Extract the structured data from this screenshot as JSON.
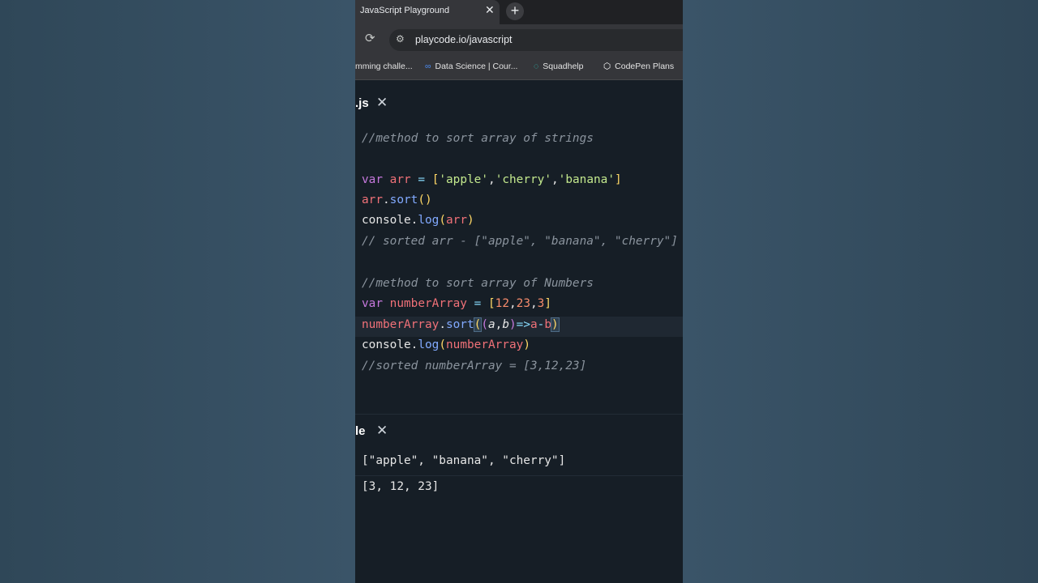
{
  "browser": {
    "tab_title": "JavaScript Playground",
    "tab_close": "✕",
    "new_tab": "+",
    "url": "playcode.io/javascript",
    "bookmarks": [
      {
        "label": "mming challe...",
        "icon": "bookmark-icon"
      },
      {
        "label": "Data Science | Cour...",
        "icon": "infinity-icon"
      },
      {
        "label": "Squadhelp",
        "icon": "squadhelp-icon"
      },
      {
        "label": "CodePen Plans",
        "icon": "codepen-icon"
      }
    ]
  },
  "editor": {
    "tab_label": ".js",
    "tab_close": "✕",
    "lines": {
      "l1": "//method to sort array of strings",
      "l5": "// sorted arr - [\"apple\", \"banana\", \"cherry\"]",
      "l7": "//method to sort array of Numbers",
      "l11": "//sorted numberArray = [3,12,23]"
    }
  },
  "console": {
    "tab_label": "le",
    "tab_close": "✕",
    "outputs": [
      "[\"apple\", \"banana\", \"cherry\"]",
      "[3, 12, 23]"
    ]
  },
  "colors": {
    "editor_bg": "#161e26",
    "keyword": "#c678dd",
    "variable": "#f07178",
    "string": "#c3e88d",
    "function": "#82aaff",
    "number": "#f78c6c",
    "comment": "#8b949e"
  }
}
